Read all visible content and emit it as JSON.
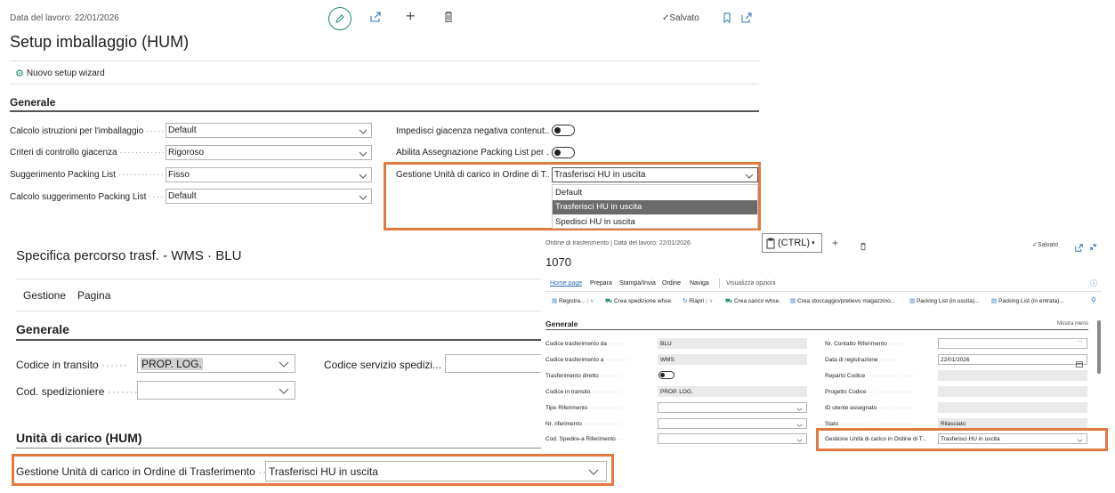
{
  "setup": {
    "work_date": "Data del lavoro: 22/01/2026",
    "saved": "Salvato",
    "title": "Setup imballaggio (HUM)",
    "wizard": "Nuovo setup wizard",
    "section": "Generale",
    "fields_left": [
      {
        "label": "Calcolo istruzioni per l'imballaggio",
        "value": "Default"
      },
      {
        "label": "Criteri di controllo giacenza",
        "value": "Rigoroso"
      },
      {
        "label": "Suggerimento Packing List",
        "value": "Fisso"
      },
      {
        "label": "Calcolo suggerimento Packing List",
        "value": "Default"
      }
    ],
    "fields_right": [
      {
        "label": "Impedisci giacenza negativa contenut..."
      },
      {
        "label": "Abilita Assegnazione Packing List per ..."
      }
    ],
    "hu_field": {
      "label": "Gestione Unità di carico in Ordine di T...",
      "value": "Trasferisci HU in uscita"
    },
    "dropdown_options": [
      "Default",
      "Trasferisci HU in uscita",
      "Spedisci HU in uscita"
    ]
  },
  "route": {
    "title": "Specifica percorso trasf. - WMS · BLU",
    "menu": [
      "Gestione",
      "Pagina"
    ],
    "section": "Generale",
    "transit_label": "Codice in transito",
    "transit_value": "PROP. LOG.",
    "shipping_service_label": "Codice servizio spedizi...",
    "carrier_label": "Cod. spedizioniere",
    "hum_section": "Unità di carico (HUM)",
    "hum_label": "Gestione Unità di carico in Ordine di Trasferimento",
    "hum_value": "Trasferisci HU in uscita"
  },
  "order": {
    "breadcrumb": "Ordine di trasferimento | Data del lavoro: 22/01/2026",
    "number": "1070",
    "saved": "Salvato",
    "paste_tooltip": "(CTRL)",
    "tabs": [
      "Home page",
      "Prepara",
      "Stampa/Invia",
      "Ordine",
      "Naviga",
      "Visualizza opzioni"
    ],
    "actions": [
      "Registra...",
      "Crea spedizione whse.",
      "Riapri",
      "Crea carico whse.",
      "Crea stoccaggio/prelievo magazzino...",
      "Packing List (in uscita)...",
      "Packing List (in entrata)..."
    ],
    "section": "Generale",
    "show_less": "Mostra meno",
    "left_fields": [
      {
        "label": "Codice trasferimento da",
        "value": "BLU"
      },
      {
        "label": "Codice trasferimento a",
        "value": "WMS"
      },
      {
        "label": "Trasferimento diretto",
        "value": ""
      },
      {
        "label": "Codice in transito",
        "value": "PROP. LOG."
      },
      {
        "label": "Tipo Riferimento",
        "value": ""
      },
      {
        "label": "Nr. riferimento",
        "value": ""
      },
      {
        "label": "Cod. Spedire-a Riferimento",
        "value": ""
      }
    ],
    "right_fields": [
      {
        "label": "Nr. Contatto Riferimento",
        "value": ""
      },
      {
        "label": "Data di registrazione",
        "value": "22/01/2026"
      },
      {
        "label": "Reparto Codice",
        "value": ""
      },
      {
        "label": "Progetto Codice",
        "value": ""
      },
      {
        "label": "ID utente assegnato",
        "value": ""
      },
      {
        "label": "Stato",
        "value": "Rilasciato"
      },
      {
        "label": "Gestione Unità di carico in Ordine di T...",
        "value": "Trasferisci HU in uscita"
      }
    ]
  },
  "colors": {
    "accent_orange": "#e07a3f",
    "link_blue": "#2c6fb7",
    "teal": "#1f8a70"
  }
}
